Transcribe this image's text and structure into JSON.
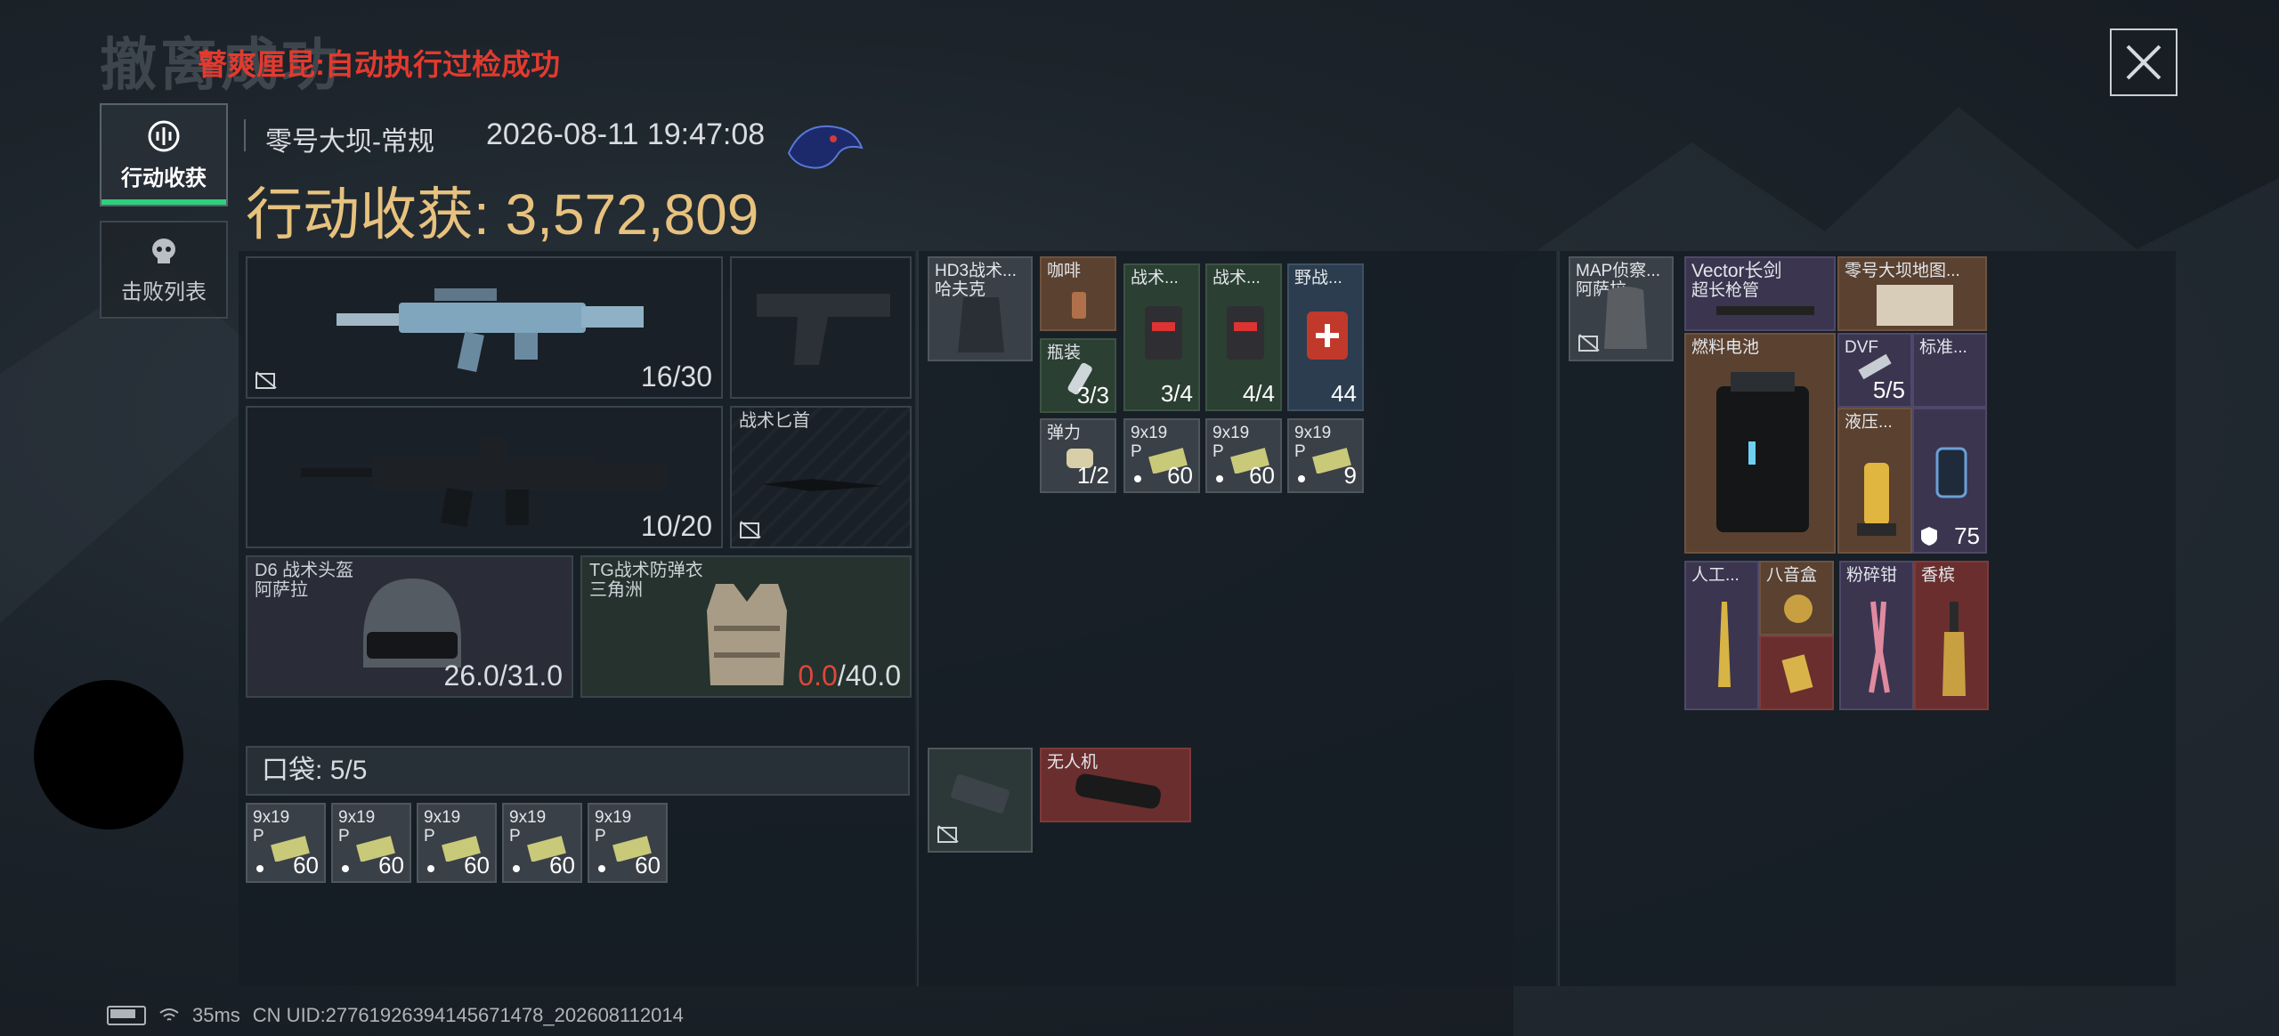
{
  "ghost_title": "撤离成功",
  "notice": "瞽爽厘昆:自动执行过检成功",
  "tabs": [
    {
      "label": "行动收获",
      "icon": "loot-icon",
      "active": true
    },
    {
      "label": "击败列表",
      "icon": "skull-icon",
      "active": false
    }
  ],
  "session": {
    "map_mode": "零号大坝-常规",
    "datetime": "2026-08-11 19:47:08",
    "earnings_label": "行动收获:",
    "earnings_value": "3,572,809"
  },
  "loadout": {
    "primary_ammo": "16/30",
    "secondary_ammo": "10/20",
    "melee_label": "战术匕首",
    "helmet": {
      "name": "D6 战术头盔",
      "brand": "阿萨拉",
      "durability": "26.0/31.0"
    },
    "armor": {
      "name": "TG战术防弹衣",
      "brand": "三角洲",
      "durability_current": "0.0",
      "durability_max": "/40.0"
    }
  },
  "pocket": {
    "label": "口袋:",
    "count": "5/5"
  },
  "pocket_items": [
    {
      "name": "9x19",
      "sub": "P",
      "count": "60"
    },
    {
      "name": "9x19",
      "sub": "P",
      "count": "60"
    },
    {
      "name": "9x19",
      "sub": "P",
      "count": "60"
    },
    {
      "name": "9x19",
      "sub": "P",
      "count": "60"
    },
    {
      "name": "9x19",
      "sub": "P",
      "count": "60"
    }
  ],
  "rig": {
    "name": "HD3战术...",
    "brand": "哈夫克",
    "items": [
      {
        "name": "咖啡",
        "count": ""
      },
      {
        "name": "战术...",
        "count": "3/4"
      },
      {
        "name": "战术...",
        "count": "4/4"
      },
      {
        "name": "野战...",
        "count": "44"
      },
      {
        "name": "瓶装",
        "count": "3/3"
      },
      {
        "name": "弹力",
        "count": "1/2"
      },
      {
        "name": "9x19",
        "sub": "P",
        "count": "60"
      },
      {
        "name": "9x19",
        "sub": "P",
        "count": "60"
      },
      {
        "name": "9x19",
        "sub": "P",
        "count": "9"
      }
    ],
    "drone_label": "无人机"
  },
  "backpack": {
    "name": "MAP侦察...",
    "brand": "阿萨拉",
    "items": [
      {
        "name": "Vector长剑",
        "sub": "超长枪管"
      },
      {
        "name": "零号大坝地图..."
      },
      {
        "name": "燃料电池"
      },
      {
        "name": "DVF",
        "count": "5/5"
      },
      {
        "name": "标准..."
      },
      {
        "name": "液压..."
      },
      {
        "name": "",
        "count": "75"
      },
      {
        "name": "人工..."
      },
      {
        "name": "八音盒"
      },
      {
        "name": "粉碎钳"
      },
      {
        "name": "香槟"
      }
    ]
  },
  "status": {
    "ping": "35ms",
    "uid": "CN UID:2776192639414567147​8_202608112014"
  }
}
